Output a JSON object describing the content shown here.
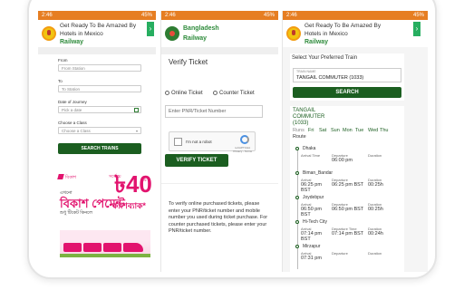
{
  "status": {
    "time": "2:46",
    "battery": "45%"
  },
  "pane1": {
    "ad": {
      "line1": "Get Ready To Be Amazed By",
      "line2": "Hotels in Mexico",
      "brand": "Railway"
    },
    "form": {
      "from_label": "From",
      "from_placeholder": "From Station",
      "to_label": "To",
      "to_placeholder": "To Station",
      "date_label": "Date of Journey",
      "date_placeholder": "Pick a date",
      "class_label": "Choose a Class",
      "class_placeholder": "Choose a Class",
      "search_label": "SEARCH TRAINS"
    },
    "promo": {
      "brand": "বিকাশ",
      "line1": "এখনো",
      "line2": "বিকাশ পেমেন্ট",
      "line3": "শুধু টিকেট কিনলে",
      "upto": "সর্বোচ্চ",
      "amount": "৳40",
      "pct": "%",
      "cashback": "ক্যাশব্যাক*"
    }
  },
  "pane2": {
    "brand": {
      "line1": "Bangladesh",
      "line2": "Railway"
    },
    "title": "Verify Ticket",
    "options": {
      "online": "Online Ticket",
      "counter": "Counter Ticket"
    },
    "pnr_placeholder": "Enter PNR/Ticket Number",
    "captcha": {
      "text": "I'm not a robot",
      "brand": "reCAPTCHA",
      "links": "Privacy - Terms"
    },
    "verify_label": "VERIFY TICKET",
    "info": "To verify online purchased tickets, please enter your PNR/ticket number and mobile number you used during ticket purchase. For counter purchased tickets, please enter your PNR/ticket number."
  },
  "pane3": {
    "ad": {
      "line1": "Get Ready To Be Amazed By",
      "line2": "Hotels in Mexico",
      "brand": "Railway"
    },
    "select_title": "Select Your Preferred Train",
    "train_label": "TRAIN NAME",
    "train_value": "TANGAIL COMMUTER (1033)",
    "search_label": "SEARCH",
    "train_name": "TANGAIL COMMUTER (1033)",
    "runs_label": "Runs",
    "days": [
      "Fri",
      "Sat",
      "Sun",
      "Mon",
      "Tue",
      "Wed",
      "Thu"
    ],
    "route_label": "Route",
    "stations": [
      {
        "name": "Dhaka",
        "arr_label": "Arrival Time",
        "arr": "",
        "dep_label": "Departure",
        "dep": "06:00 pm",
        "dur_label": "Duration",
        "dur": ""
      },
      {
        "name": "Biman_Bandar",
        "arr_label": "Arrival",
        "arr": "06:25 pm BST",
        "dep_label": "Departure",
        "dep": "06:25 pm BST",
        "dur_label": "Duration",
        "dur": "00:25h"
      },
      {
        "name": "Joydebpur",
        "arr_label": "Arrival",
        "arr": "06:50 pm BST",
        "dep_label": "Departure",
        "dep": "06:50 pm BST",
        "dur_label": "Duration",
        "dur": "00:25h"
      },
      {
        "name": "Hi-Tech City",
        "arr_label": "Arrival",
        "arr": "07:14 pm BST",
        "dep_label": "Departure Time",
        "dep": "07:14 pm BST",
        "dur_label": "Duration",
        "dur": "00:24h"
      },
      {
        "name": "Mirzapur",
        "arr_label": "Arrival",
        "arr": "07:31 pm",
        "dep_label": "Departure",
        "dep": "",
        "dur_label": "Duration",
        "dur": ""
      }
    ]
  }
}
